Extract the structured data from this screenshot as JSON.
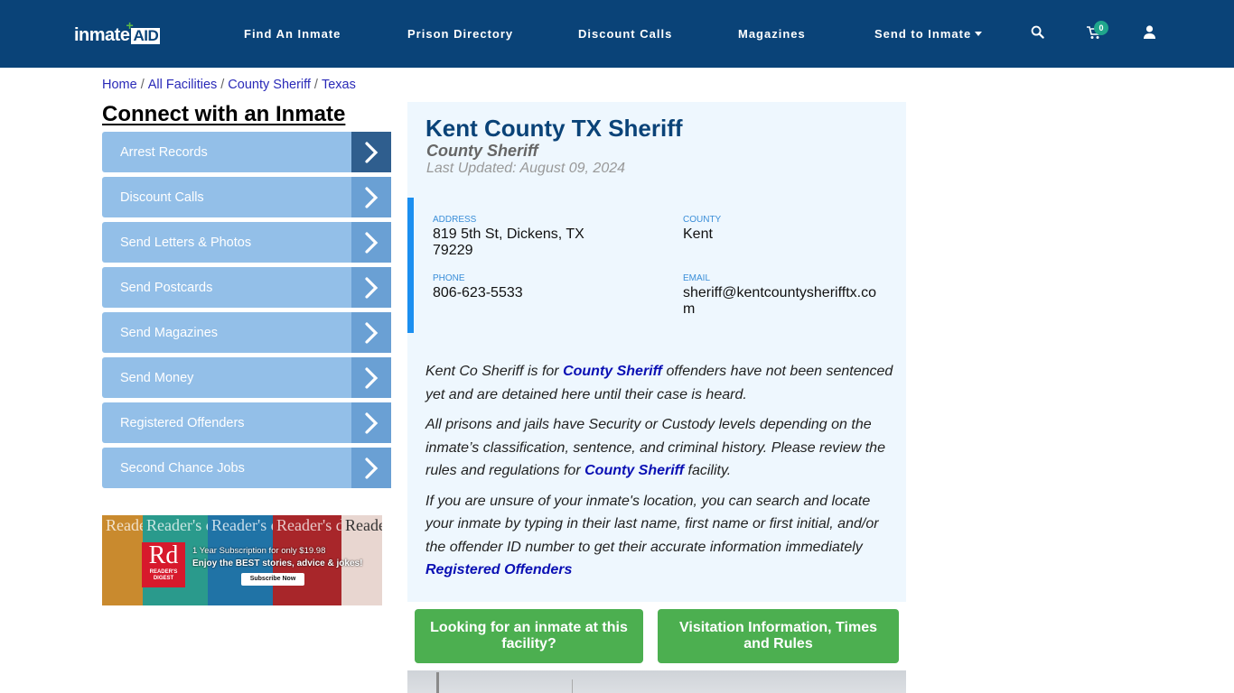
{
  "header": {
    "logo": {
      "text_left": "inmate",
      "text_right": "AID",
      "plus": "+"
    },
    "nav": [
      {
        "label": "Find An Inmate"
      },
      {
        "label": "Prison Directory"
      },
      {
        "label": "Discount Calls"
      },
      {
        "label": "Magazines"
      },
      {
        "label": "Send to Inmate",
        "has_dropdown": true
      }
    ],
    "icons": {
      "search": "search-icon",
      "cart": "cart-icon",
      "user": "user-icon"
    },
    "cart_count": "0",
    "colors": {
      "background": "#0a4378",
      "badge": "#20a68c"
    }
  },
  "breadcrumb": {
    "items": [
      {
        "label": "Home"
      },
      {
        "label": "All Facilities"
      },
      {
        "label": "County Sheriff"
      },
      {
        "label": "Texas"
      }
    ],
    "separator": "/"
  },
  "sidebar": {
    "title": "Connect with an Inmate",
    "items": [
      {
        "label": "Arrest Records",
        "active": true
      },
      {
        "label": "Discount Calls"
      },
      {
        "label": "Send Letters & Photos"
      },
      {
        "label": "Send Postcards"
      },
      {
        "label": "Send Magazines"
      },
      {
        "label": "Send Money"
      },
      {
        "label": "Registered Offenders"
      },
      {
        "label": "Second Chance Jobs"
      }
    ],
    "ad": {
      "brand_mark": "Rd",
      "brand_name": "READER'S DIGEST",
      "masthead": "Reader's digest",
      "line1": "1 Year Subscription for only $19.98",
      "line2": "Enjoy the BEST stories, advice & jokes!",
      "cta": "Subscribe Now"
    }
  },
  "facility": {
    "name": "Kent County TX Sheriff",
    "type": "County Sheriff",
    "last_updated": "Last Updated: August 09, 2024",
    "info": {
      "address_label": "ADDRESS",
      "address_line1": "819 5th St, Dickens, TX",
      "address_line2": "79229",
      "county_label": "COUNTY",
      "county": "Kent",
      "phone_label": "PHONE",
      "phone": "806-623-5533",
      "email_label": "EMAIL",
      "email_line1": "sheriff@kentcountysherifftx.co",
      "email_line2": "m"
    },
    "description": {
      "p1_before": "Kent Co Sheriff is for ",
      "p1_link": "County Sheriff",
      "p1_after": " offenders have not been sentenced yet and are detained here until their case is heard.",
      "p2_before": "All prisons and jails have Security or Custody levels depending on the inmate’s classification, sentence, and criminal history. Please review the rules and regulations for ",
      "p2_link": "County Sheriff",
      "p2_after": " facility.",
      "p3": "If you are unsure of your inmate's location, you can search and locate your inmate by typing in their last name, first name or first initial, and/or the offender ID number to get their accurate information immediately",
      "p3_link": "Registered Offenders"
    }
  },
  "actions": {
    "find_inmate": "Looking for an inmate at this facility?",
    "visitation": "Visitation Information, Times and Rules",
    "color": "#4caf50"
  }
}
